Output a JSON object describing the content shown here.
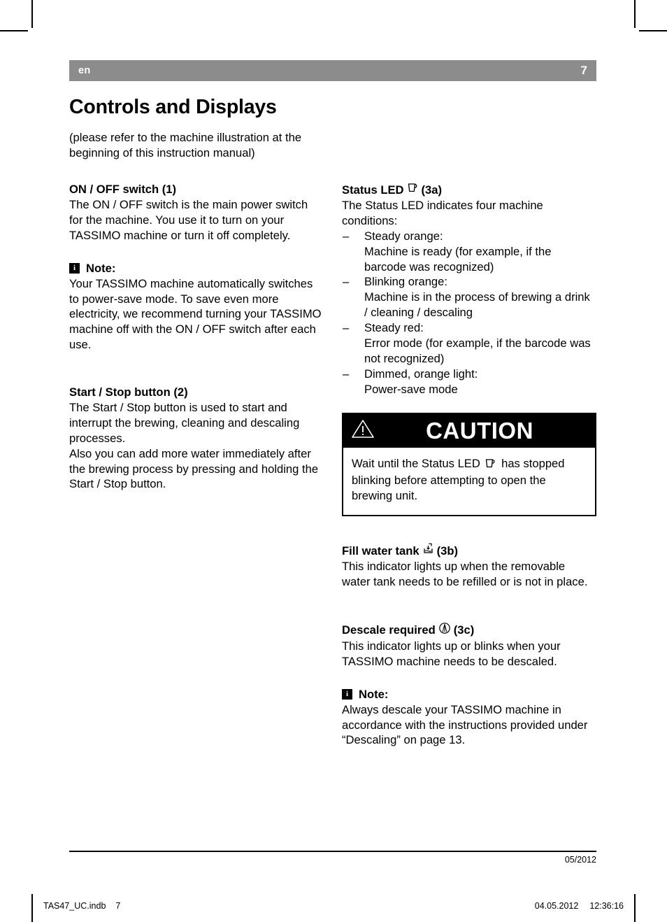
{
  "header": {
    "language": "en",
    "page_number": "7"
  },
  "title": "Controls and Displays",
  "intro": "(please refer to the machine illustration at the beginning of this instruction manual)",
  "left_column": {
    "onoff": {
      "heading": "ON / OFF switch (1)",
      "body": "The ON / OFF switch is the main power switch for the machine. You use it to turn on your TASSIMO machine or turn it off completely."
    },
    "note1": {
      "icon": "info-icon",
      "label": "Note:",
      "body": "Your TASSIMO machine automatically switches to power-save mode. To save even more electricity, we recommend turning your TASSIMO machine off with the ON / OFF switch after each use."
    },
    "startstop": {
      "heading": "Start / Stop button (2)",
      "body1": "The Start / Stop button is used to start and interrupt the brewing, cleaning and descaling processes.",
      "body2": "Also you can add more water immediately after the brewing process by pressing and holding the Start / Stop button."
    }
  },
  "right_column": {
    "status_led": {
      "heading_before": "Status LED",
      "heading_icon": "coffee-cup-icon",
      "heading_after": "(3a)",
      "body": "The Status LED indicates four machine conditions:",
      "items": [
        {
          "dash": "–",
          "term": "Steady orange:",
          "desc": "Machine is ready (for example, if the barcode was recognized)"
        },
        {
          "dash": "–",
          "term": "Blinking orange:",
          "desc": "Machine is in the process of brewing a drink / cleaning / descaling"
        },
        {
          "dash": "–",
          "term": "Steady red:",
          "desc": "Error mode (for example, if the barcode was not recognized)"
        },
        {
          "dash": "–",
          "term": "Dimmed, orange light:",
          "desc": "Power-save mode"
        }
      ]
    },
    "caution": {
      "icon": "warning-triangle-icon",
      "title": "CAUTION",
      "body_before": "Wait until the Status LED",
      "body_icon": "coffee-cup-icon",
      "body_after": "has stopped blinking before attempting to open the brewing unit."
    },
    "fill_water_tank": {
      "heading_before": "Fill water tank",
      "heading_icon": "water-tank-icon",
      "heading_after": "(3b)",
      "body": "This indicator lights up when the removable water tank needs to be refilled or is not in place."
    },
    "descale_required": {
      "heading_before": "Descale required",
      "heading_icon": "descale-icon",
      "heading_after": "(3c)",
      "body": "This indicator lights up or blinks when your TASSIMO machine needs to be descaled."
    },
    "note2": {
      "icon": "info-icon",
      "label": "Note:",
      "body": "Always descale your TASSIMO machine in accordance with the instructions provided under “Descaling” on page 13."
    }
  },
  "footer": {
    "revision_date": "05/2012",
    "file_name": "TAS47_UC.indb",
    "file_page": "7",
    "print_date": "04.05.2012",
    "print_time": "12:36:16"
  },
  "colors": {
    "header_bar": "#8c8c8c",
    "caution_header": "#000000",
    "text": "#000000",
    "page_background": "#ffffff"
  }
}
